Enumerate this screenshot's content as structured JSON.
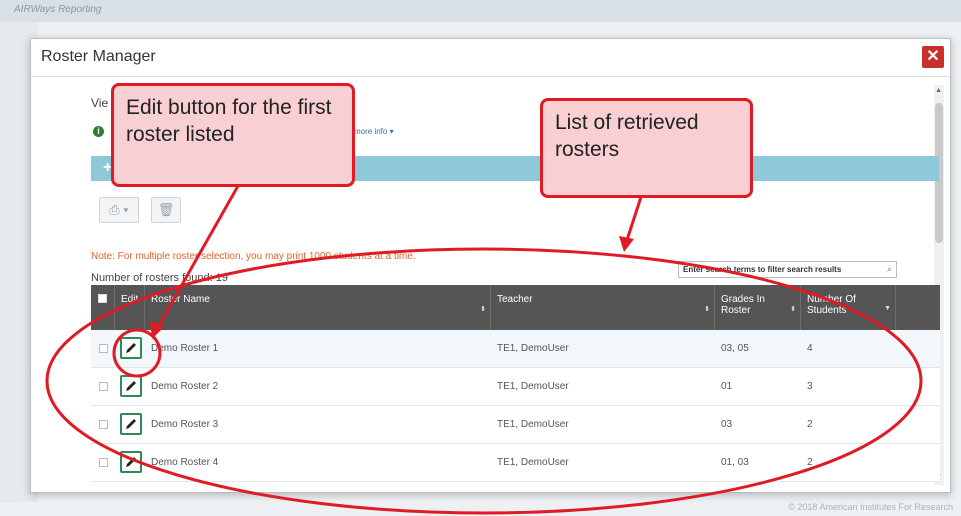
{
  "app": {
    "name": "AIRWays Reporting",
    "footer": "© 2018 American Institutes For Research"
  },
  "modal": {
    "title": "Roster Manager",
    "close_icon": "close-icon",
    "intro_text": "Vie",
    "more_info_link": "more info",
    "add_icon": "plus-icon",
    "print_icon": "print-icon",
    "delete_icon": "trash-icon",
    "note": "Note: For multiple roster selection, you may print 1000 students at a time.",
    "roster_count_label": "Number of rosters found: 19",
    "search": {
      "placeholder": "Enter search terms to filter search results",
      "icon": "search-icon"
    }
  },
  "table": {
    "columns": [
      "",
      "Edit",
      "Roster Name",
      "Teacher",
      "Grades In Roster",
      "Number Of Students"
    ],
    "headers": {
      "edit": "Edit",
      "roster_name": "Roster Name",
      "teacher": "Teacher",
      "grades": "Grades In Roster",
      "students": "Number Of Students"
    },
    "rows": [
      {
        "roster_name": "Demo Roster 1",
        "teacher": "TE1, DemoUser",
        "grades": "03, 05",
        "students": "4"
      },
      {
        "roster_name": "Demo Roster 2",
        "teacher": "TE1, DemoUser",
        "grades": "01",
        "students": "3"
      },
      {
        "roster_name": "Demo Roster 3",
        "teacher": "TE1, DemoUser",
        "grades": "03",
        "students": "2"
      },
      {
        "roster_name": "Demo Roster 4",
        "teacher": "TE1, DemoUser",
        "grades": "01, 03",
        "students": "2"
      }
    ]
  },
  "annotations": {
    "edit_callout": "Edit button for the first roster listed",
    "list_callout": "List of retrieved rosters",
    "color": "#e01b24",
    "fill": "#f8cfd3"
  }
}
